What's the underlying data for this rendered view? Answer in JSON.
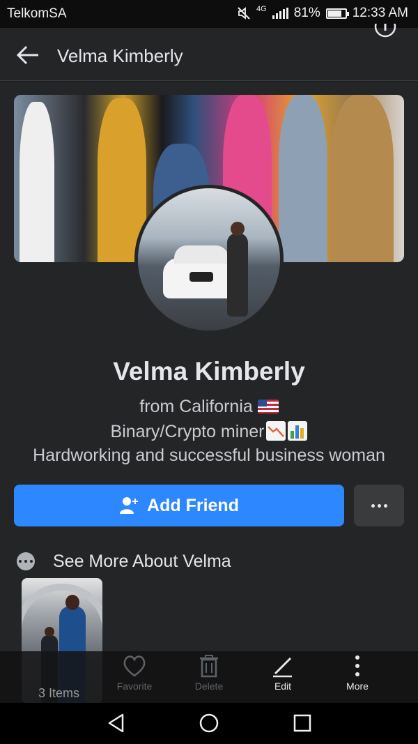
{
  "status_bar": {
    "carrier": "TelkomSA",
    "network": "4G",
    "battery": "81%",
    "battery_level": 0.81,
    "time": "12:33 AM",
    "icons": [
      "mute-icon",
      "signal-icon",
      "battery-icon"
    ]
  },
  "header": {
    "title": "Velma Kimberly",
    "icons": [
      "back-arrow-icon",
      "info-icon"
    ]
  },
  "profile": {
    "name": "Velma Kimberly",
    "bio": {
      "line1_text": "from  California ",
      "line1_emoji": "flag-us-icon",
      "line2_text": "Binary/Crypto miner",
      "line2_emojis": [
        "chart-decreasing-icon",
        "bar-chart-icon"
      ],
      "line3_text": "Hardworking and successful business woman"
    }
  },
  "actions": {
    "add_friend_label": "Add Friend",
    "add_friend_icon": "add-user-icon",
    "more_icon": "more-dots-icon"
  },
  "see_more": {
    "label": "See More About Velma",
    "icon": "more-dots-circle-icon"
  },
  "gallery_bar": {
    "items_count": "3 Items",
    "buttons": [
      {
        "label": "Favorite",
        "icon": "heart-icon",
        "enabled": false
      },
      {
        "label": "Delete",
        "icon": "trash-icon",
        "enabled": false
      },
      {
        "label": "Edit",
        "icon": "pencil-icon",
        "enabled": true
      },
      {
        "label": "More",
        "icon": "vertical-dots-icon",
        "enabled": true
      }
    ]
  },
  "nav_bar": {
    "icons": [
      "back-triangle-icon",
      "home-circle-icon",
      "recents-square-icon"
    ]
  },
  "colors": {
    "background": "#242526",
    "accent_blue": "#2d88ff",
    "text_primary": "#e4e6eb"
  }
}
